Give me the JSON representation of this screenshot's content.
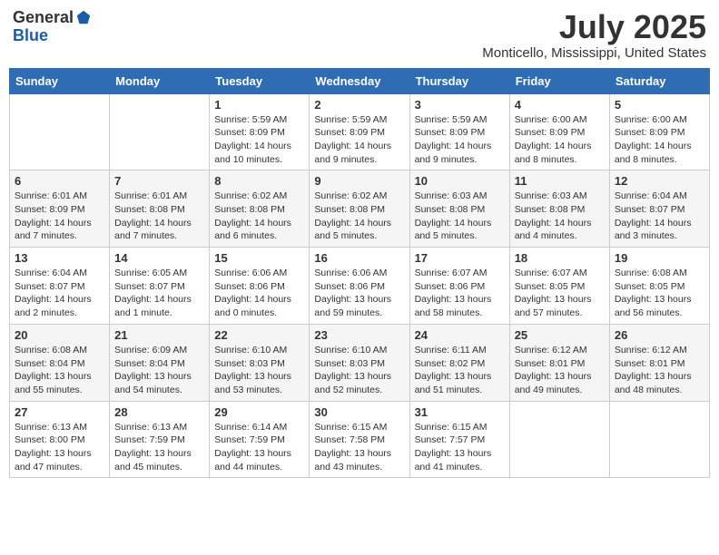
{
  "header": {
    "logo_general": "General",
    "logo_blue": "Blue",
    "month_title": "July 2025",
    "location": "Monticello, Mississippi, United States"
  },
  "weekdays": [
    "Sunday",
    "Monday",
    "Tuesday",
    "Wednesday",
    "Thursday",
    "Friday",
    "Saturday"
  ],
  "weeks": [
    [
      {
        "day": "",
        "info": ""
      },
      {
        "day": "",
        "info": ""
      },
      {
        "day": "1",
        "info": "Sunrise: 5:59 AM\nSunset: 8:09 PM\nDaylight: 14 hours and 10 minutes."
      },
      {
        "day": "2",
        "info": "Sunrise: 5:59 AM\nSunset: 8:09 PM\nDaylight: 14 hours and 9 minutes."
      },
      {
        "day": "3",
        "info": "Sunrise: 5:59 AM\nSunset: 8:09 PM\nDaylight: 14 hours and 9 minutes."
      },
      {
        "day": "4",
        "info": "Sunrise: 6:00 AM\nSunset: 8:09 PM\nDaylight: 14 hours and 8 minutes."
      },
      {
        "day": "5",
        "info": "Sunrise: 6:00 AM\nSunset: 8:09 PM\nDaylight: 14 hours and 8 minutes."
      }
    ],
    [
      {
        "day": "6",
        "info": "Sunrise: 6:01 AM\nSunset: 8:09 PM\nDaylight: 14 hours and 7 minutes."
      },
      {
        "day": "7",
        "info": "Sunrise: 6:01 AM\nSunset: 8:08 PM\nDaylight: 14 hours and 7 minutes."
      },
      {
        "day": "8",
        "info": "Sunrise: 6:02 AM\nSunset: 8:08 PM\nDaylight: 14 hours and 6 minutes."
      },
      {
        "day": "9",
        "info": "Sunrise: 6:02 AM\nSunset: 8:08 PM\nDaylight: 14 hours and 5 minutes."
      },
      {
        "day": "10",
        "info": "Sunrise: 6:03 AM\nSunset: 8:08 PM\nDaylight: 14 hours and 5 minutes."
      },
      {
        "day": "11",
        "info": "Sunrise: 6:03 AM\nSunset: 8:08 PM\nDaylight: 14 hours and 4 minutes."
      },
      {
        "day": "12",
        "info": "Sunrise: 6:04 AM\nSunset: 8:07 PM\nDaylight: 14 hours and 3 minutes."
      }
    ],
    [
      {
        "day": "13",
        "info": "Sunrise: 6:04 AM\nSunset: 8:07 PM\nDaylight: 14 hours and 2 minutes."
      },
      {
        "day": "14",
        "info": "Sunrise: 6:05 AM\nSunset: 8:07 PM\nDaylight: 14 hours and 1 minute."
      },
      {
        "day": "15",
        "info": "Sunrise: 6:06 AM\nSunset: 8:06 PM\nDaylight: 14 hours and 0 minutes."
      },
      {
        "day": "16",
        "info": "Sunrise: 6:06 AM\nSunset: 8:06 PM\nDaylight: 13 hours and 59 minutes."
      },
      {
        "day": "17",
        "info": "Sunrise: 6:07 AM\nSunset: 8:06 PM\nDaylight: 13 hours and 58 minutes."
      },
      {
        "day": "18",
        "info": "Sunrise: 6:07 AM\nSunset: 8:05 PM\nDaylight: 13 hours and 57 minutes."
      },
      {
        "day": "19",
        "info": "Sunrise: 6:08 AM\nSunset: 8:05 PM\nDaylight: 13 hours and 56 minutes."
      }
    ],
    [
      {
        "day": "20",
        "info": "Sunrise: 6:08 AM\nSunset: 8:04 PM\nDaylight: 13 hours and 55 minutes."
      },
      {
        "day": "21",
        "info": "Sunrise: 6:09 AM\nSunset: 8:04 PM\nDaylight: 13 hours and 54 minutes."
      },
      {
        "day": "22",
        "info": "Sunrise: 6:10 AM\nSunset: 8:03 PM\nDaylight: 13 hours and 53 minutes."
      },
      {
        "day": "23",
        "info": "Sunrise: 6:10 AM\nSunset: 8:03 PM\nDaylight: 13 hours and 52 minutes."
      },
      {
        "day": "24",
        "info": "Sunrise: 6:11 AM\nSunset: 8:02 PM\nDaylight: 13 hours and 51 minutes."
      },
      {
        "day": "25",
        "info": "Sunrise: 6:12 AM\nSunset: 8:01 PM\nDaylight: 13 hours and 49 minutes."
      },
      {
        "day": "26",
        "info": "Sunrise: 6:12 AM\nSunset: 8:01 PM\nDaylight: 13 hours and 48 minutes."
      }
    ],
    [
      {
        "day": "27",
        "info": "Sunrise: 6:13 AM\nSunset: 8:00 PM\nDaylight: 13 hours and 47 minutes."
      },
      {
        "day": "28",
        "info": "Sunrise: 6:13 AM\nSunset: 7:59 PM\nDaylight: 13 hours and 45 minutes."
      },
      {
        "day": "29",
        "info": "Sunrise: 6:14 AM\nSunset: 7:59 PM\nDaylight: 13 hours and 44 minutes."
      },
      {
        "day": "30",
        "info": "Sunrise: 6:15 AM\nSunset: 7:58 PM\nDaylight: 13 hours and 43 minutes."
      },
      {
        "day": "31",
        "info": "Sunrise: 6:15 AM\nSunset: 7:57 PM\nDaylight: 13 hours and 41 minutes."
      },
      {
        "day": "",
        "info": ""
      },
      {
        "day": "",
        "info": ""
      }
    ]
  ]
}
